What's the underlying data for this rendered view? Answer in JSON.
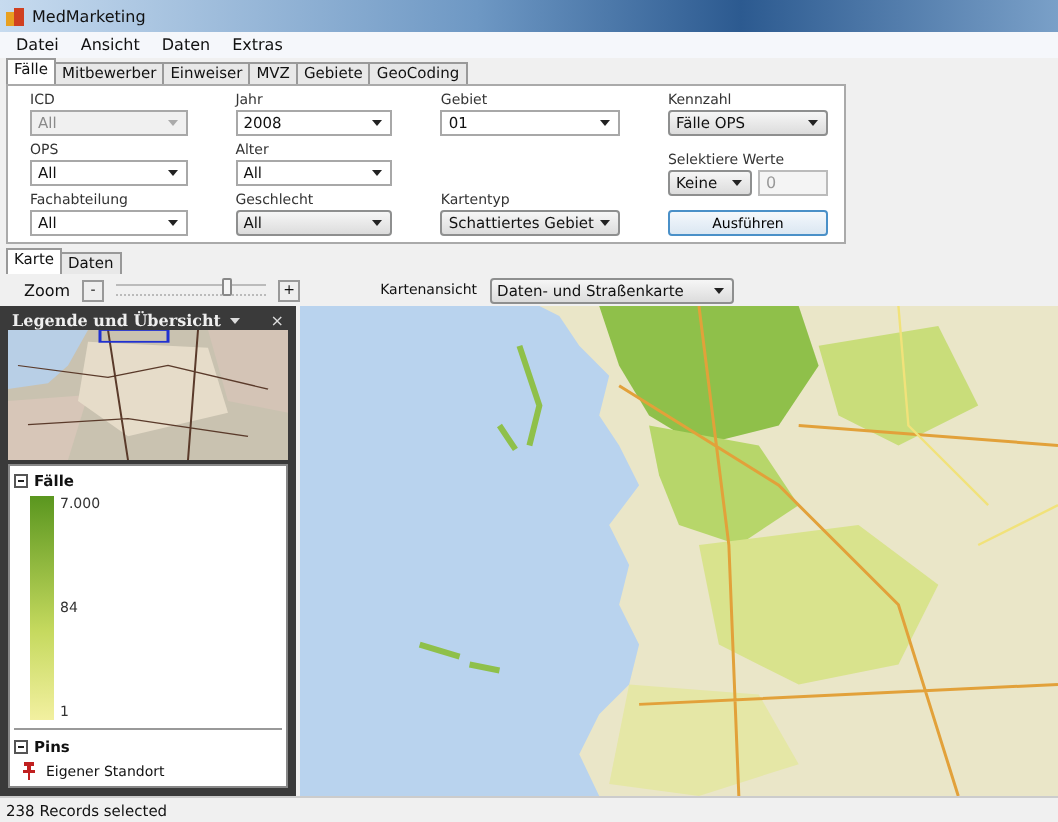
{
  "window": {
    "title": "MedMarketing"
  },
  "menu": [
    "Datei",
    "Ansicht",
    "Daten",
    "Extras"
  ],
  "tabs": [
    {
      "label": "Fälle",
      "selected": true
    },
    {
      "label": "Mitbewerber",
      "selected": false
    },
    {
      "label": "Einweiser",
      "selected": false
    },
    {
      "label": "MVZ",
      "selected": false
    },
    {
      "label": "Gebiete",
      "selected": false
    },
    {
      "label": "GeoCoding",
      "selected": false
    }
  ],
  "filter_columns": [
    [
      {
        "label": "ICD",
        "kind": "combo",
        "value": "All",
        "disabled": true
      },
      {
        "label": "OPS",
        "kind": "combo",
        "value": "All",
        "disabled": false
      },
      {
        "label": "Fachabteilung",
        "kind": "combo",
        "value": "All",
        "disabled": false
      }
    ],
    [
      {
        "label": "Jahr",
        "kind": "combo",
        "value": "2008",
        "disabled": false
      },
      {
        "label": "Alter",
        "kind": "combo",
        "value": "All",
        "disabled": false
      },
      {
        "label": "Geschlecht",
        "kind": "dropdown",
        "value": "All",
        "disabled": false
      }
    ],
    [
      {
        "label": "Gebiet",
        "kind": "combo",
        "value": "01",
        "disabled": false
      },
      {
        "label": "Kartentyp",
        "kind": "dropdown",
        "value": "Schattiertes Gebiet",
        "disabled": false
      }
    ],
    [
      {
        "label": "Kennzahl",
        "kind": "dropdown",
        "value": "Fälle OPS",
        "disabled": false
      },
      {
        "label": "Selektiere Werte",
        "kind": "dropdown_field",
        "value": "Keine",
        "field": "0",
        "disabled": false
      },
      {
        "label": "Ausführen",
        "kind": "button",
        "disabled": false
      }
    ]
  ],
  "map_tabs": [
    {
      "label": "Karte",
      "selected": true
    },
    {
      "label": "Daten",
      "selected": false
    }
  ],
  "zoom": {
    "label": "Zoom",
    "minus": "-",
    "plus": "+",
    "level": 0.75
  },
  "map_view": {
    "label": "Kartenansicht",
    "value": "Daten- und Straßenkarte"
  },
  "legend": {
    "title": "Legende und Übersicht",
    "close": "×",
    "sections": [
      {
        "title": "Fälle",
        "kind": "gradient",
        "expanded": true,
        "labels": [
          "7.000",
          "84",
          "1"
        ]
      },
      {
        "title": "Pins",
        "kind": "pins",
        "expanded": true,
        "items": [
          "Eigener Standort"
        ]
      }
    ]
  },
  "status_bar": "238 Records selected"
}
